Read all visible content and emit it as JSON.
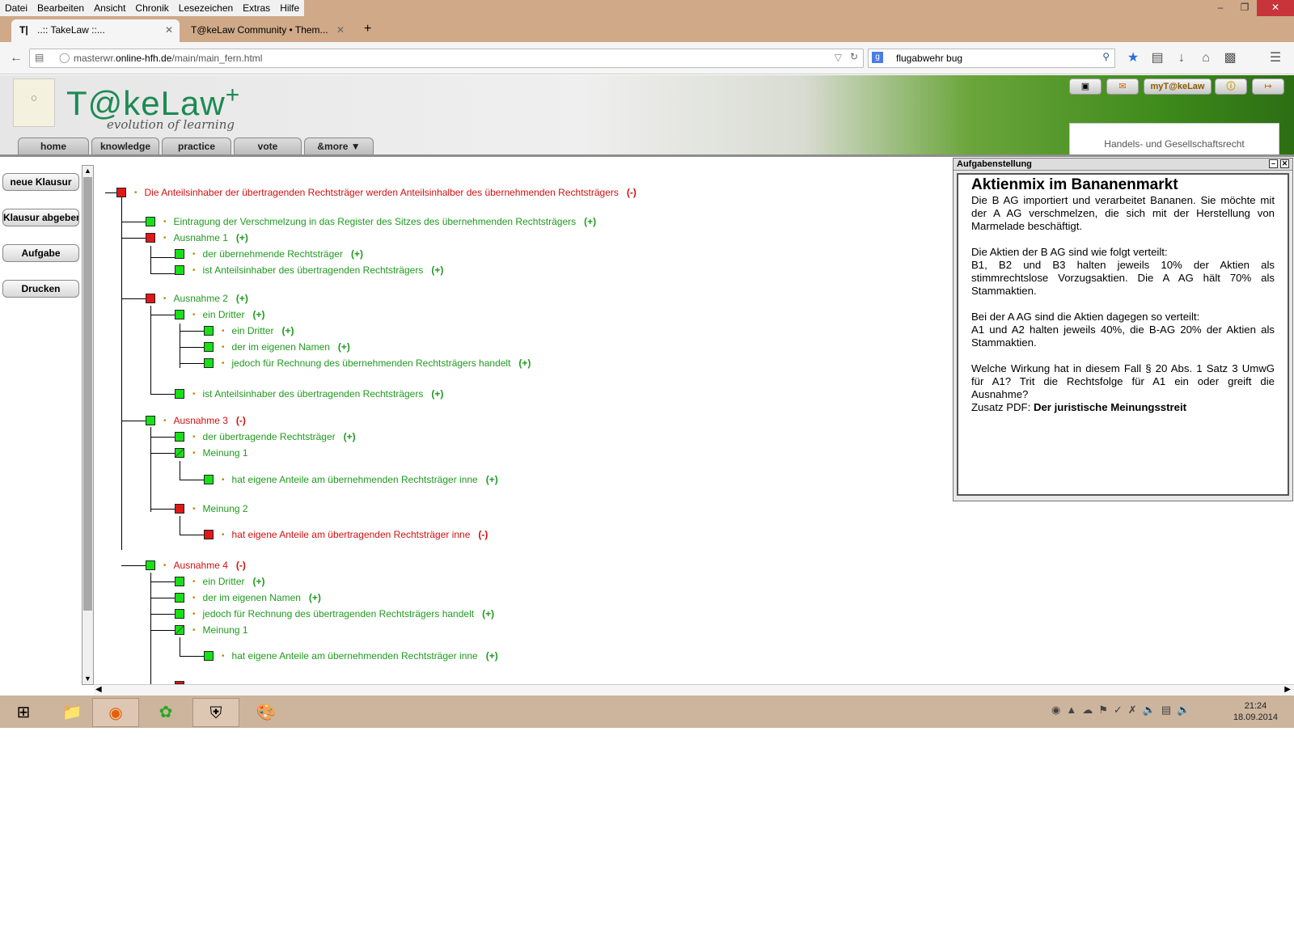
{
  "browser": {
    "menu": [
      "Datei",
      "Bearbeiten",
      "Ansicht",
      "Chronik",
      "Lesezeichen",
      "Extras",
      "Hilfe"
    ],
    "tabs": [
      {
        "label": "..:: TakeLaw ::..."
      },
      {
        "label": "T@keLaw Community • Them..."
      }
    ],
    "url_prefix": "masterwr.",
    "url_domain": "online-hfh.de",
    "url_path": "/main/main_fern.html",
    "search_value": "flugabwehr bug"
  },
  "site": {
    "brand": "T@keLaw",
    "brand_plus": "+",
    "tagline": "evolution of learning",
    "nav": [
      "home",
      "knowledge",
      "practice",
      "vote",
      "&more"
    ],
    "header_buttons": [
      "myT@keLaw"
    ],
    "course": "Handels- und Gesellschaftsrecht"
  },
  "sidebar": {
    "buttons": [
      "neue Klausur",
      "Klausur abgeben",
      "Aufgabe",
      "Drucken"
    ]
  },
  "tree": {
    "nodes": [
      {
        "label": "Die Anteilsinhaber der übertragenden Rechtsträger werden Anteilsinhalber des übernehmenden Rechtsträgers",
        "result": "(-)",
        "status": "ko"
      },
      {
        "label": "Eintragung der Verschmelzung in das Register des Sitzes des übernehmenden Rechtsträgers",
        "result": "(+)",
        "status": "ok"
      },
      {
        "label": "Ausnahme 1",
        "result": "(+)",
        "status": "ok"
      },
      {
        "label": "der übernehmende Rechtsträger",
        "result": "(+)",
        "status": "ok"
      },
      {
        "label": "ist Anteilsinhaber des übertragenden Rechtsträgers",
        "result": "(+)",
        "status": "ok"
      },
      {
        "label": "Ausnahme 2",
        "result": "(+)",
        "status": "ok"
      },
      {
        "label": "ein Dritter",
        "result": "(+)",
        "status": "ok"
      },
      {
        "label": "ein Dritter",
        "result": "(+)",
        "status": "ok"
      },
      {
        "label": "der im eigenen Namen",
        "result": "(+)",
        "status": "ok"
      },
      {
        "label": "jedoch für Rechnung des übernehmenden Rechtsträgers handelt",
        "result": "(+)",
        "status": "ok"
      },
      {
        "label": "ist Anteilsinhaber des übertragenden Rechtsträgers",
        "result": "(+)",
        "status": "ok"
      },
      {
        "label": "Ausnahme 3",
        "result": "(-)",
        "status": "ko"
      },
      {
        "label": "der übertragende Rechtsträger",
        "result": "(+)",
        "status": "ok"
      },
      {
        "label": "Meinung 1",
        "result": "",
        "status": "ok"
      },
      {
        "label": "hat eigene Anteile am übernehmenden Rechtsträger inne",
        "result": "(+)",
        "status": "ok"
      },
      {
        "label": "Meinung 2",
        "result": "",
        "status": "ok"
      },
      {
        "label": "hat eigene Anteile am übertragenden Rechtsträger inne",
        "result": "(-)",
        "status": "ko"
      },
      {
        "label": "Ausnahme 4",
        "result": "(-)",
        "status": "ko"
      },
      {
        "label": "ein Dritter",
        "result": "(+)",
        "status": "ok"
      },
      {
        "label": "der im eigenen Namen",
        "result": "(+)",
        "status": "ok"
      },
      {
        "label": "jedoch für Rechnung des übertragenden Rechtsträgers handelt",
        "result": "(+)",
        "status": "ok"
      },
      {
        "label": "Meinung 1",
        "result": "",
        "status": "ok"
      },
      {
        "label": "hat eigene Anteile am übernehmenden Rechtsträger inne",
        "result": "(+)",
        "status": "ok"
      }
    ]
  },
  "task": {
    "panel_title": "Aufgabenstellung",
    "title": "Aktienmix im Bananenmarkt",
    "p1": "Die B AG importiert und verarbeitet Bananen. Sie möchte mit der A AG verschmelzen, die sich mit der Herstellung von Marmelade beschäftigt.",
    "p2a": "Die Aktien der B AG sind wie folgt verteilt:",
    "p2b": "B1, B2 und B3 halten jeweils 10% der Aktien als stimmrechtslose Vorzugsaktien. Die A AG hält 70% als Stammaktien.",
    "p3a": "Bei der A AG sind die Aktien dagegen so verteilt:",
    "p3b": "A1 und A2 halten jeweils 40%, die B-AG 20% der Aktien als Stammaktien.",
    "p4": "Welche Wirkung hat in diesem Fall § 20 Abs. 1 Satz 3 UmwG für A1? Trit die Rechtsfolge für A1 ein oder greift die Ausnahme?",
    "pdf_prefix": "Zusatz PDF:",
    "pdf_link": "Der juristische Meinungsstreit"
  },
  "taskbar": {
    "time": "21:24",
    "date": "18.09.2014"
  }
}
